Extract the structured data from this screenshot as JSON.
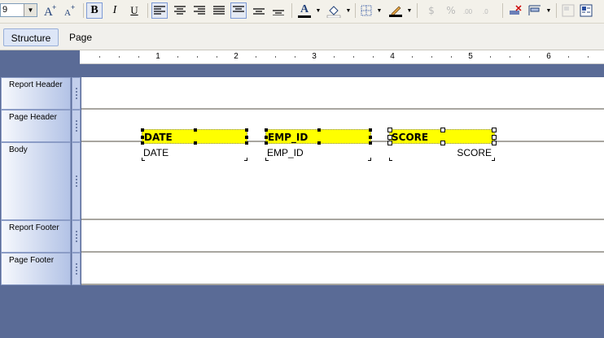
{
  "toolbar": {
    "font_size": "9",
    "buttons": {
      "bold": "B",
      "italic": "I",
      "underline": "U",
      "font_color_letter": "A",
      "currency": "$",
      "percent": "%"
    }
  },
  "tabs": [
    {
      "label": "Structure",
      "active": true
    },
    {
      "label": "Page",
      "active": false
    }
  ],
  "ruler": {
    "marks": [
      "1",
      "2",
      "3",
      "4",
      "5",
      "6"
    ]
  },
  "sections": [
    {
      "label": "Report Header"
    },
    {
      "label": "Page Header"
    },
    {
      "label": "Body"
    },
    {
      "label": "Report Footer"
    },
    {
      "label": "Page Footer"
    }
  ],
  "page_header_fields": [
    "DATE",
    "EMP_ID",
    "SCORE"
  ],
  "body_fields": [
    "DATE",
    "EMP_ID",
    "SCORE"
  ],
  "colors": {
    "header_field_bg": "#ffff00",
    "workspace_bg": "#5a6b96",
    "section_label_gradient_end": "#b3c3e6"
  }
}
